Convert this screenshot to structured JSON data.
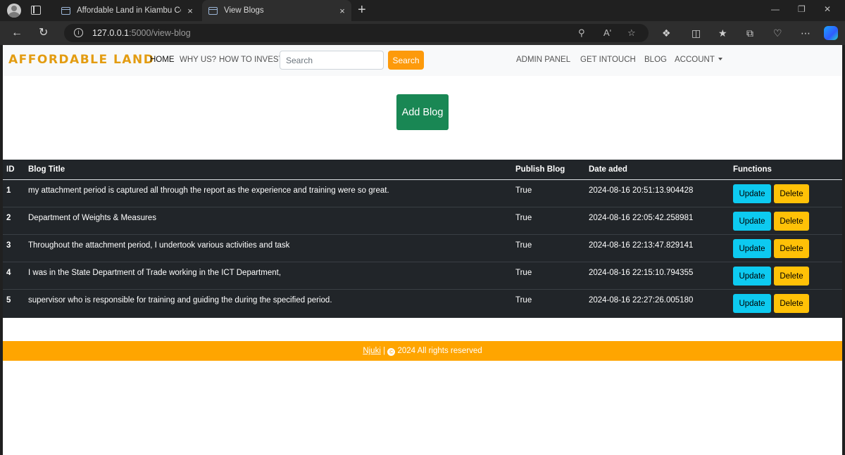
{
  "browser": {
    "tabs": [
      {
        "title": "Affordable Land in Kiambu Coun",
        "close": "×"
      },
      {
        "title": "View Blogs",
        "close": "×"
      }
    ],
    "new_tab": "+",
    "url_host": "127.0.0.1",
    "url_path": ":5000/view-blog",
    "read_aloud": "Aʹ"
  },
  "nav": {
    "brand": "AFFORDABLE LAND",
    "links": [
      "HOME",
      "WHY US?",
      "HOW TO INVEST"
    ],
    "search_placeholder": "Search",
    "search_button": "Search",
    "right_links": [
      "ADMIN PANEL",
      "GET INTOUCH",
      "BLOG",
      "ACCOUNT"
    ]
  },
  "add_blog_label": "Add Blog",
  "table": {
    "headers": [
      "ID",
      "Blog Title",
      "Publish Blog",
      "Date aded",
      "Functions"
    ],
    "rows": [
      {
        "id": "1",
        "title": "my attachment period is captured all through the report as the experience and training were so great.",
        "publish": "True",
        "date": "2024-08-16 20:51:13.904428"
      },
      {
        "id": "2",
        "title": "Department of Weights & Measures",
        "publish": "True",
        "date": "2024-08-16 22:05:42.258981"
      },
      {
        "id": "3",
        "title": "Throughout the attachment period, I undertook various activities and task",
        "publish": "True",
        "date": "2024-08-16 22:13:47.829141"
      },
      {
        "id": "4",
        "title": "I was in the State Department of Trade working in the ICT Department,",
        "publish": "True",
        "date": "2024-08-16 22:15:10.794355"
      },
      {
        "id": "5",
        "title": "supervisor who is responsible for training and guiding the during the specified period.",
        "publish": "True",
        "date": "2024-08-16 22:27:26.005180"
      }
    ],
    "update_label": "Update",
    "delete_label": "Delete"
  },
  "footer": {
    "author": "Njuki",
    "separator": "|",
    "rights": "2024 All rights reserved"
  },
  "colors": {
    "brand": "#e39c11",
    "search_button": "#fd9a0b",
    "add_blog": "#198754",
    "table_bg": "#212529",
    "update": "#0dcaf0",
    "delete": "#ffc107",
    "footer": "#ffa500"
  }
}
